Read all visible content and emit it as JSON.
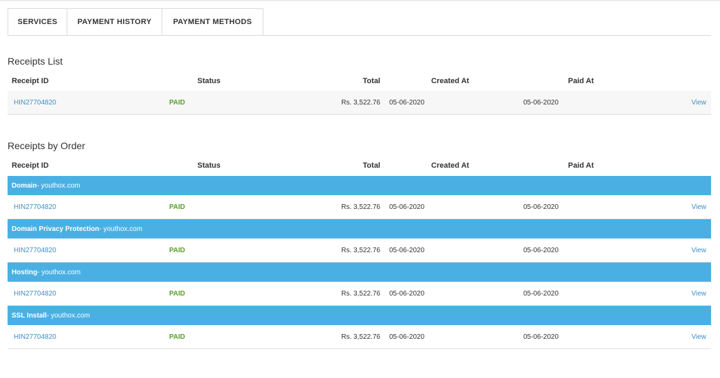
{
  "tabs": [
    {
      "label": "SERVICES"
    },
    {
      "label": "PAYMENT HISTORY"
    },
    {
      "label": "PAYMENT METHODS"
    }
  ],
  "columns": {
    "receipt_id": "Receipt ID",
    "status": "Status",
    "total": "Total",
    "created_at": "Created At",
    "paid_at": "Paid At"
  },
  "receipts_list": {
    "title": "Receipts List",
    "rows": [
      {
        "receipt_id": "HIN27704820",
        "status": "PAID",
        "total": "Rs. 3,522.76",
        "created_at": "05-06-2020",
        "paid_at": "05-06-2020",
        "action": "View"
      }
    ]
  },
  "receipts_by_order": {
    "title": "Receipts by Order",
    "groups": [
      {
        "name": "Domain",
        "domain": " - youthox.com",
        "row": {
          "receipt_id": "HIN27704820",
          "status": "PAID",
          "total": "Rs. 3,522.76",
          "created_at": "05-06-2020",
          "paid_at": "05-06-2020",
          "action": "View"
        }
      },
      {
        "name": "Domain Privacy Protection",
        "domain": " - youthox.com",
        "row": {
          "receipt_id": "HIN27704820",
          "status": "PAID",
          "total": "Rs. 3,522.76",
          "created_at": "05-06-2020",
          "paid_at": "05-06-2020",
          "action": "View"
        }
      },
      {
        "name": "Hosting",
        "domain": " - youthox.com",
        "row": {
          "receipt_id": "HIN27704820",
          "status": "PAID",
          "total": "Rs. 3,522.76",
          "created_at": "05-06-2020",
          "paid_at": "05-06-2020",
          "action": "View"
        }
      },
      {
        "name": "SSL Install",
        "domain": " - youthox.com",
        "row": {
          "receipt_id": "HIN27704820",
          "status": "PAID",
          "total": "Rs. 3,522.76",
          "created_at": "05-06-2020",
          "paid_at": "05-06-2020",
          "action": "View"
        }
      }
    ]
  },
  "colors": {
    "group_header": "#4ab0e3",
    "link": "#3a8fc7",
    "paid_status": "#5aa02c"
  }
}
